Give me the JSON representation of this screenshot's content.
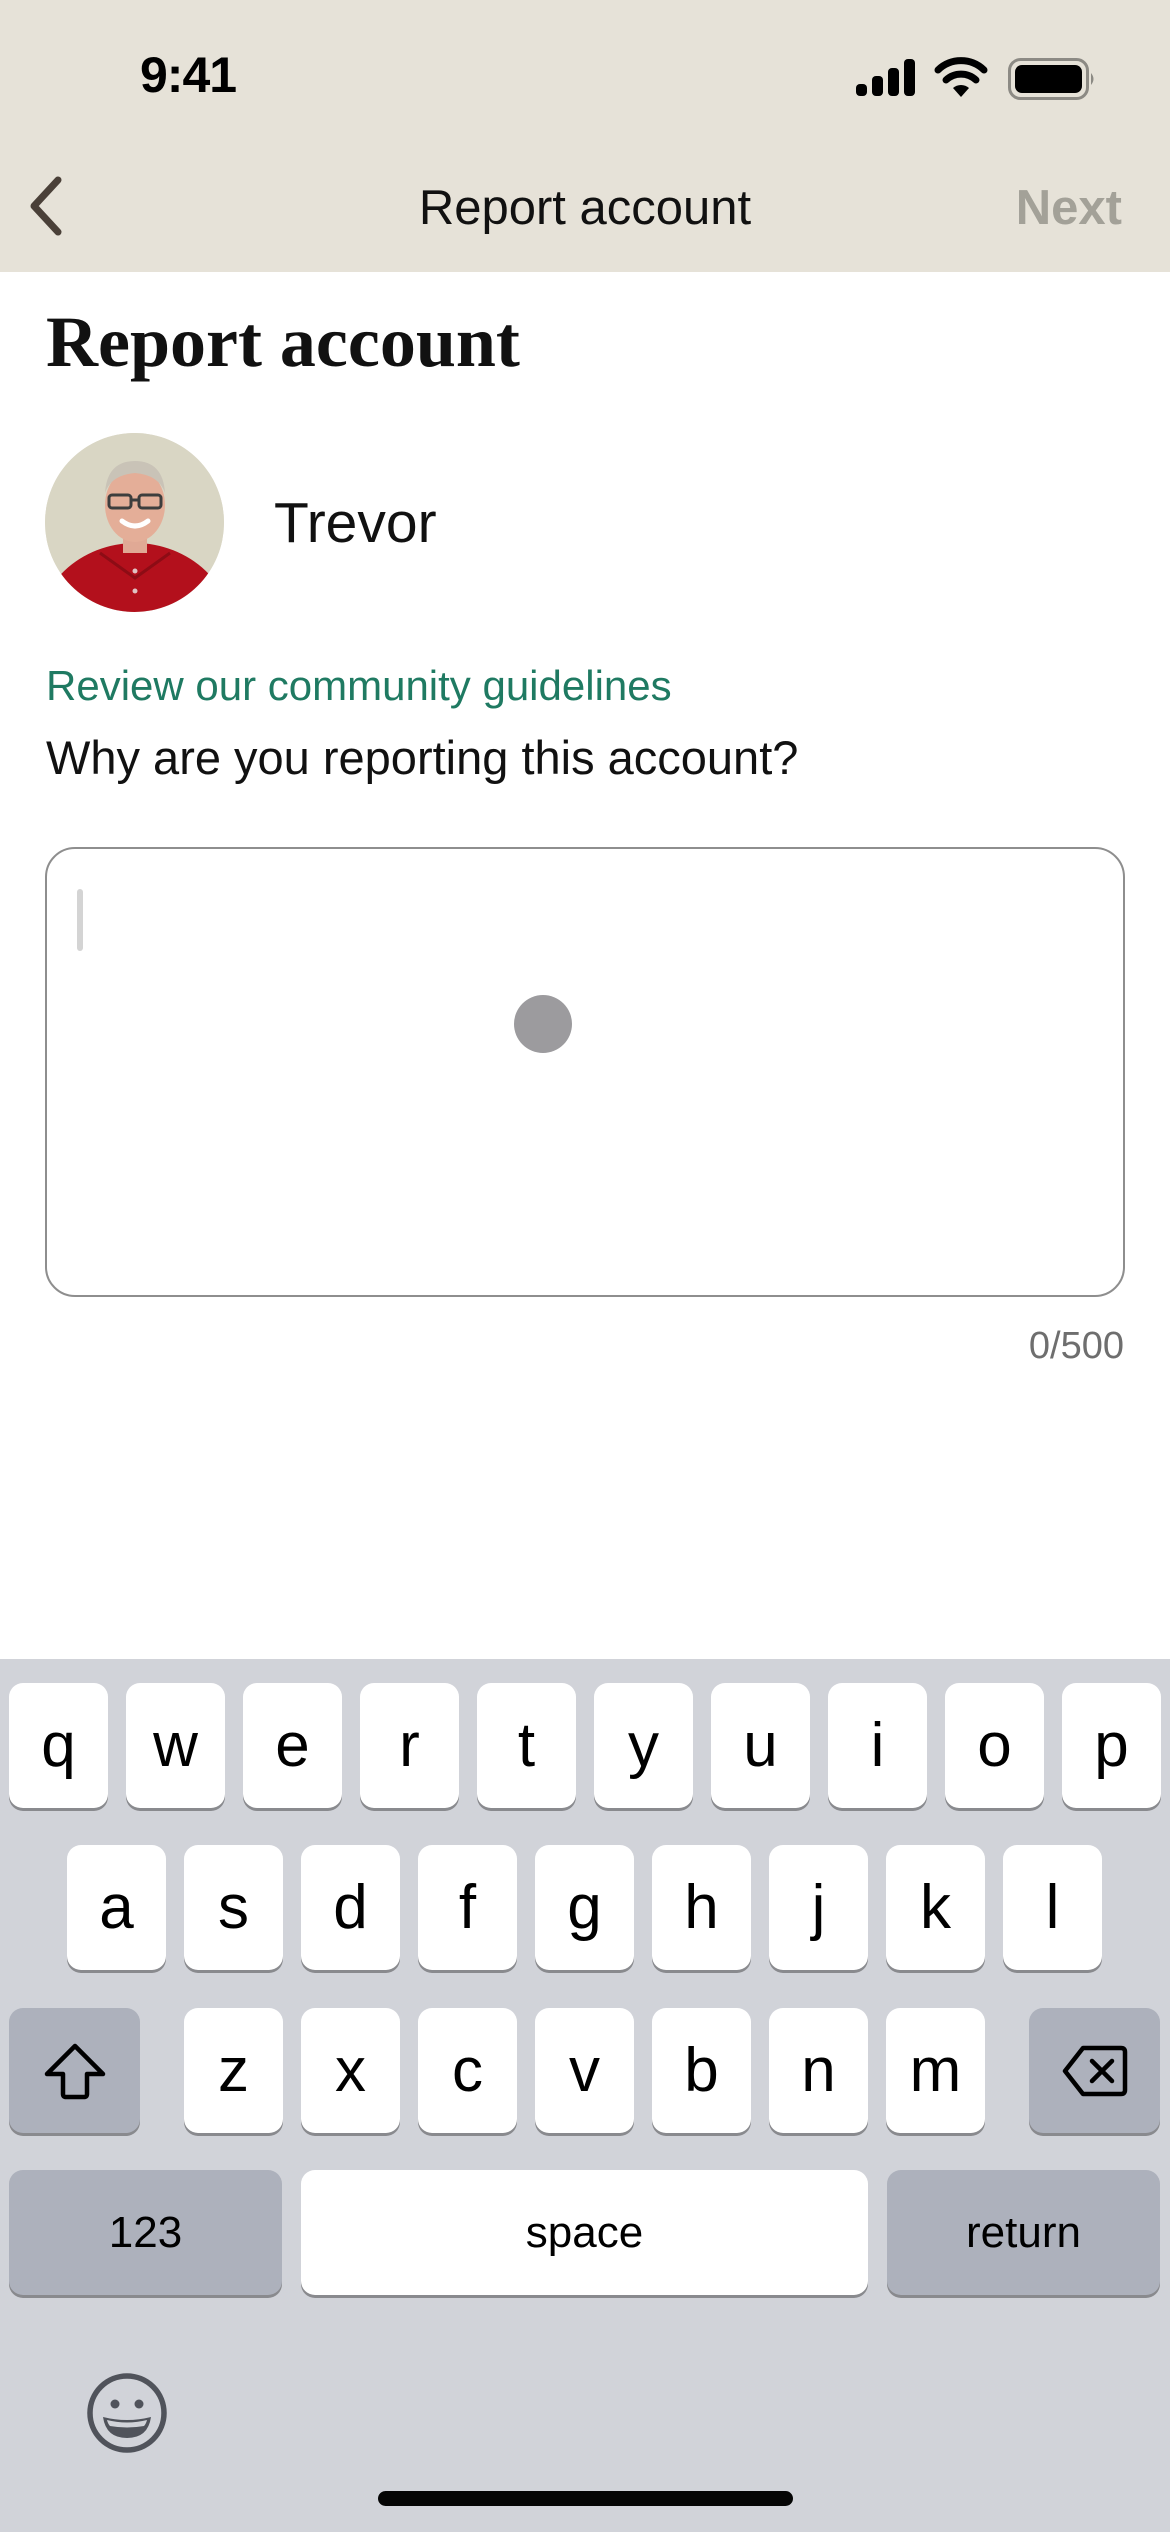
{
  "status_bar": {
    "time": "9:41",
    "icons": [
      "cellular-signal-icon",
      "wifi-icon",
      "battery-icon"
    ]
  },
  "nav": {
    "back_icon": "chevron-left-icon",
    "title": "Report account",
    "next_label": "Next",
    "next_enabled": false
  },
  "page": {
    "heading": "Report account",
    "user": {
      "name": "Trevor",
      "avatar": "profile-photo"
    },
    "guidelines_link": "Review our community guidelines",
    "question": "Why are you reporting this account?",
    "reason_input": {
      "value": "",
      "placeholder": ""
    },
    "char_counter": "0/500"
  },
  "keyboard": {
    "row1": [
      "q",
      "w",
      "e",
      "r",
      "t",
      "y",
      "u",
      "i",
      "o",
      "p"
    ],
    "row2": [
      "a",
      "s",
      "d",
      "f",
      "g",
      "h",
      "j",
      "k",
      "l"
    ],
    "row3": [
      "z",
      "x",
      "c",
      "v",
      "b",
      "n",
      "m"
    ],
    "shift_icon": "shift-icon",
    "delete_icon": "delete-backspace-icon",
    "numbers_label": "123",
    "space_label": "space",
    "return_label": "return",
    "emoji_icon": "emoji-icon"
  },
  "colors": {
    "header_bg": "#e6e2d8",
    "link": "#1f7a62",
    "next_disabled": "#a3a198",
    "keyboard_bg": "#d1d3d9",
    "fn_key": "#adb1bc"
  }
}
